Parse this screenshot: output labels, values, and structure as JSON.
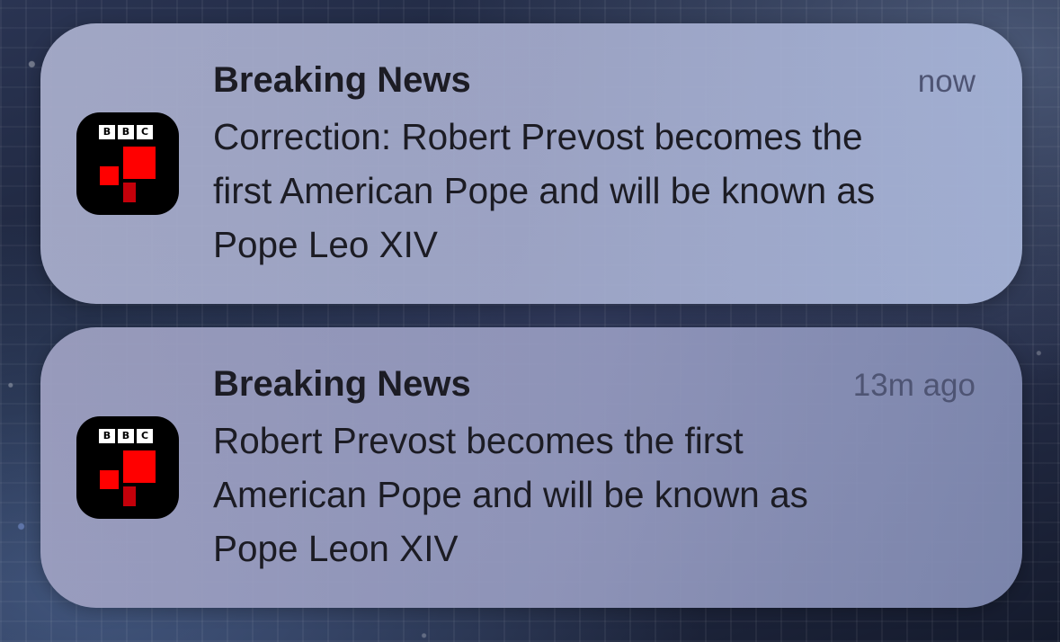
{
  "notifications": [
    {
      "app": "BBC News",
      "icon": "bbc-news-app-icon",
      "title": "Breaking News",
      "time": "now",
      "message_lines": [
        "Correction: Robert Prevost becomes the",
        "first American Pope and will be known as",
        "Pope Leo XIV"
      ]
    },
    {
      "app": "BBC News",
      "icon": "bbc-news-app-icon",
      "title": "Breaking News",
      "time": "13m ago",
      "message_lines": [
        "Robert Prevost becomes the first",
        "American Pope and will be known as",
        "Pope Leon XIV"
      ]
    }
  ],
  "icon_logo": {
    "letters": [
      "B",
      "B",
      "C"
    ],
    "accent_color": "#ff0000",
    "background_color": "#000000"
  },
  "colors": {
    "title_text": "#1c1c24",
    "time_text": "#4e5473"
  }
}
